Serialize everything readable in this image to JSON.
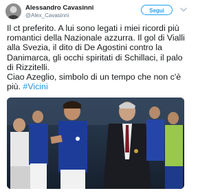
{
  "user": {
    "display_name": "Alessandro Cavasinni",
    "handle": "@Alex_Cavasinni"
  },
  "follow_button": {
    "label": "Segui"
  },
  "tweet": {
    "paragraph1": "Il ct preferito. A lui sono legati i miei ricordi più romantici della Nazionale azzurra. Il gol di Vialli alla Svezia, il dito di De Agostini contro la Danimarca, gli occhi spiritati di Schillaci, il palo di Rizzitelli.",
    "paragraph2_text": "Ciao Azeglio, simbolo di un tempo che non c'è più. ",
    "hashtag": "#Vicini"
  },
  "icons": {
    "menu": "chevron-down-icon"
  },
  "colors": {
    "accent": "#1da1f2",
    "hashtag": "#1b95e0",
    "text": "#14171a",
    "secondary_text": "#657786"
  }
}
